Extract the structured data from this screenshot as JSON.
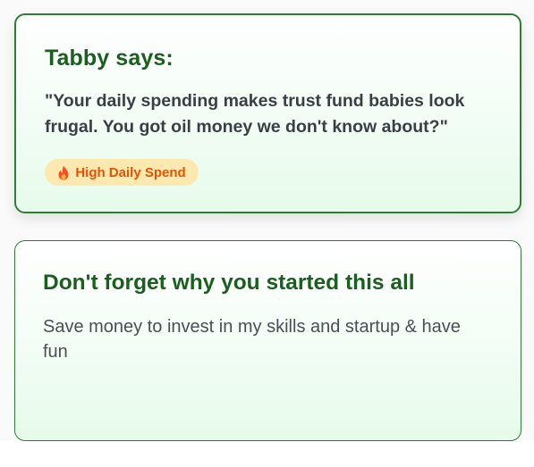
{
  "tabby_card": {
    "title": "Tabby says:",
    "quote": "\"Your daily spending makes trust fund babies look frugal. You got oil money we don't know about?\"",
    "badge": {
      "icon": "fire-icon",
      "label": "High Daily Spend"
    }
  },
  "reminder_card": {
    "title": "Don't forget why you started this all",
    "body": "Save money to invest in my skills and startup & have fun"
  },
  "colors": {
    "accent_green": "#2e7d32",
    "title_green": "#1b5e20",
    "badge_bg": "#fde9b0",
    "badge_text": "#e65100"
  }
}
